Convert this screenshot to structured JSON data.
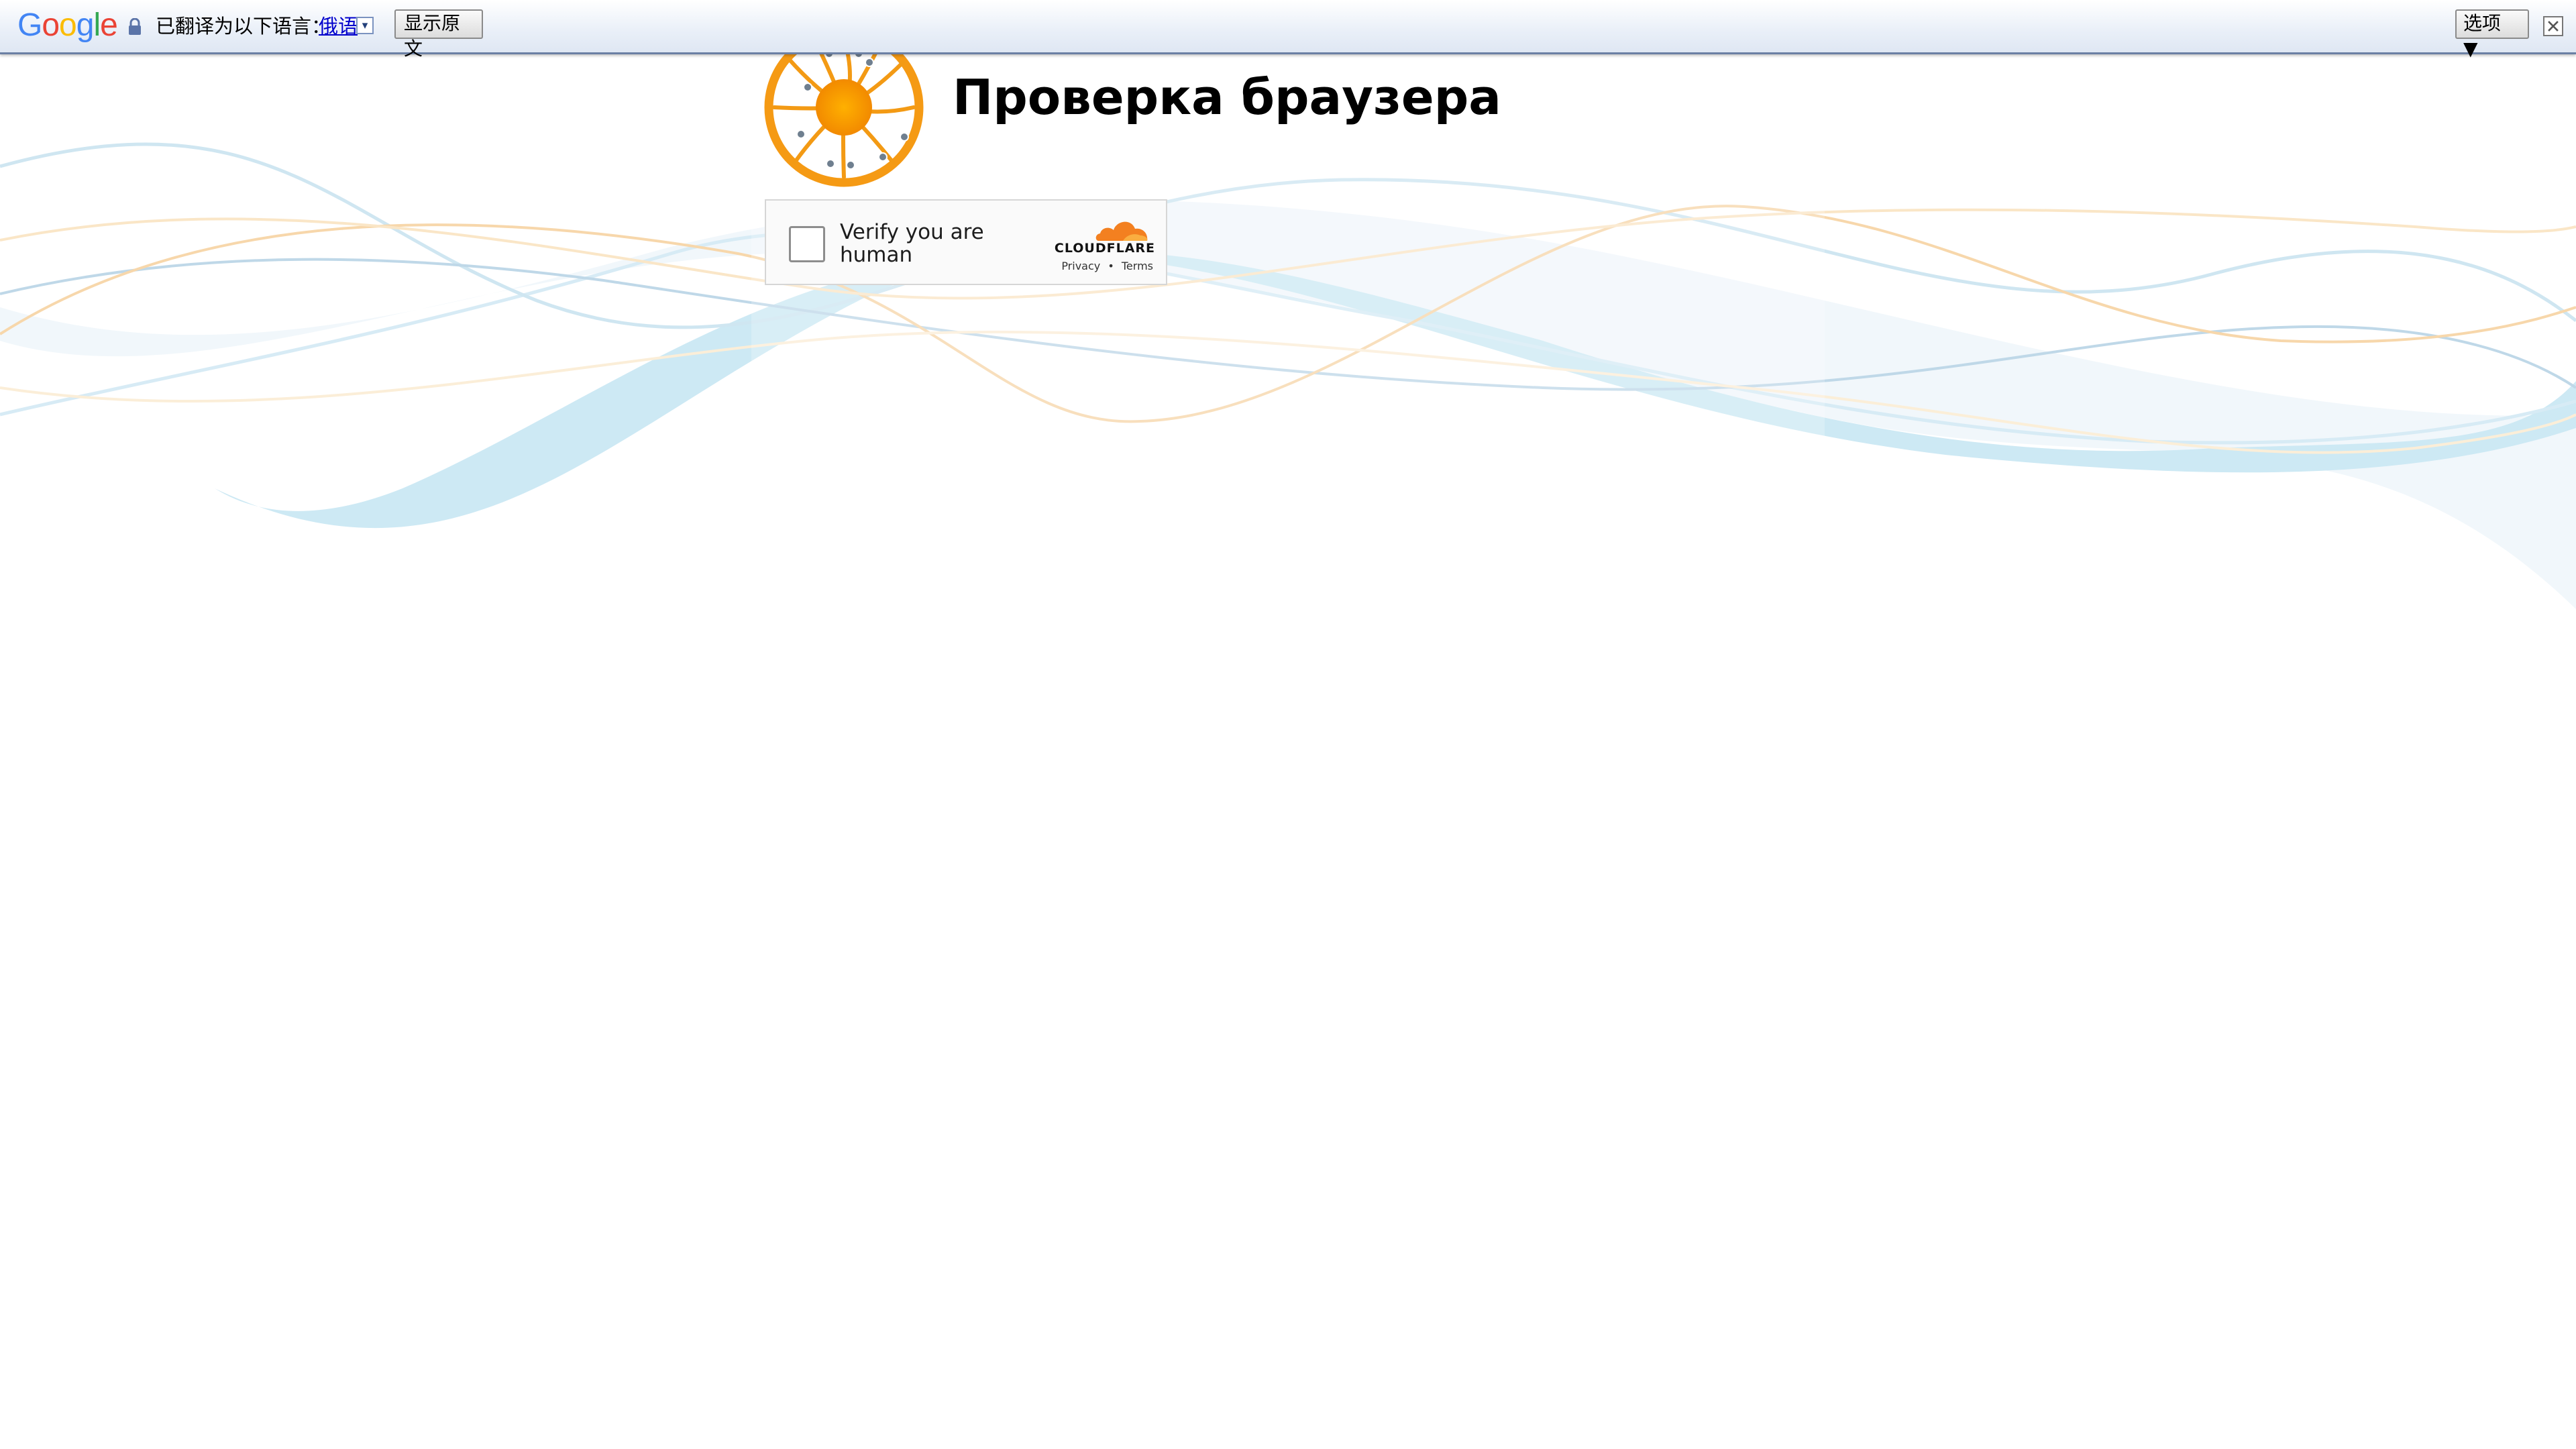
{
  "translate_bar": {
    "logo_text": "Google",
    "translated_to_label": "已翻译为以下语言：",
    "target_language": "俄语",
    "show_original_label": "显示原文",
    "options_label": "选项 ▼"
  },
  "page": {
    "title": "Проверка браузера"
  },
  "captcha": {
    "label": "Verify you are human",
    "brand": "CLOUDFLARE",
    "privacy_link": "Privacy",
    "separator": "•",
    "terms_link": "Terms"
  },
  "colors": {
    "wave_blue": "#cde9f4",
    "wave_orange": "#f6c98b",
    "logo_orange": "#f7a21c",
    "cloudflare_orange": "#f38020"
  }
}
